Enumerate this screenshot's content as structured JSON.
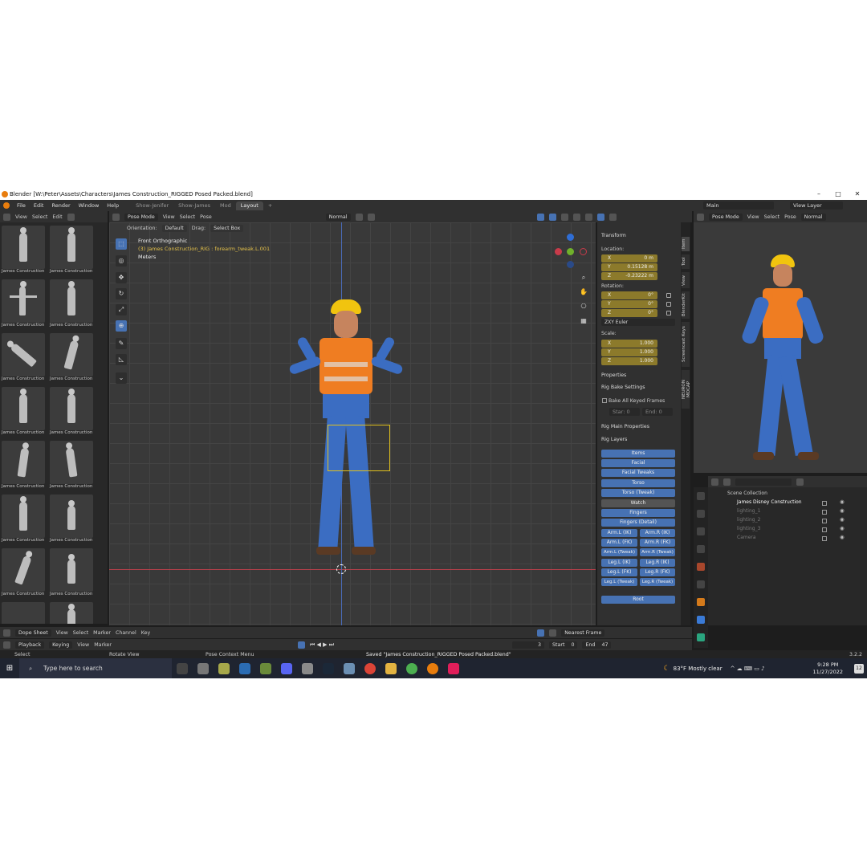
{
  "title": "Blender [W:\\Peter\\Assets\\Characters\\James Construction_RIGGED Posed Packed.blend]",
  "menu": [
    "File",
    "Edit",
    "Render",
    "Window",
    "Help"
  ],
  "workspaces": [
    "Show-Jenifer",
    "Show-James",
    "Mod",
    "Layout"
  ],
  "scene": "Main",
  "view_layer": "View Layer",
  "asset_header": {
    "view": "View",
    "select": "Select",
    "edit": "Edit"
  },
  "assets": [
    "James Construction",
    "James Construction",
    "James Construction",
    "James Construction",
    "James Construction",
    "James Construction",
    "James Construction",
    "James Construction",
    "James Construction",
    "James Construction",
    "James Construction",
    "James Construction",
    "James Construction",
    "James Construction"
  ],
  "viewport_header": {
    "mode": "Pose Mode",
    "view": "View",
    "select": "Select",
    "pose": "Pose",
    "shading": "Normal",
    "orientation_label": "Orientation:",
    "orientation": "Default",
    "drag_label": "Drag:",
    "drag": "Select Box",
    "pose_options": "Pose Options"
  },
  "viewport": {
    "view_name": "Front Orthographic",
    "object": "(3) James Construction_RIG : forearm_tweak.L.001",
    "units": "Meters"
  },
  "npanel": {
    "transform": "Transform",
    "location": "Location:",
    "loc": [
      {
        "k": "X",
        "v": "0 m"
      },
      {
        "k": "Y",
        "v": "0.15128 m"
      },
      {
        "k": "Z",
        "v": "-0.23222 m"
      }
    ],
    "rotation": "Rotation:",
    "rot": [
      {
        "k": "X",
        "v": "0°"
      },
      {
        "k": "Y",
        "v": "0°"
      },
      {
        "k": "Z",
        "v": "0°"
      }
    ],
    "rotation_mode": "ZXY Euler",
    "scale": "Scale:",
    "scl": [
      {
        "k": "X",
        "v": "1.000"
      },
      {
        "k": "Y",
        "v": "1.000"
      },
      {
        "k": "Z",
        "v": "1.000"
      }
    ],
    "properties": "Properties",
    "rig_bake": "Rig Bake Settings",
    "bake_all": "Bake All Keyed Frames",
    "start": "Star: 0",
    "end": "End: 0",
    "rig_main": "Rig Main Properties",
    "rig_layers": "Rig Layers",
    "layers_full": [
      "Items",
      "Facial",
      "Facial Tweaks",
      "Torso",
      "Torso (Tweak)",
      "Watch",
      "Fingers",
      "Fingers (Detail)"
    ],
    "layers_pairs": [
      [
        "Arm.L (IK)",
        "Arm.R (IK)"
      ],
      [
        "Arm.L (FK)",
        "Arm.R (FK)"
      ],
      [
        "Arm.L (Tweak)",
        "Arm.R (Tweak)"
      ],
      [
        "Leg.L (IK)",
        "Leg.R (IK)"
      ],
      [
        "Leg.L (FK)",
        "Leg.R (FK)"
      ],
      [
        "Leg.L (Tweak)",
        "Leg.R (Tweak)"
      ]
    ],
    "root": "Root"
  },
  "vtabs": [
    "Item",
    "Tool",
    "View",
    "BlenderKit",
    "Screencast Keys",
    "NEURON MOCAP"
  ],
  "render_header": {
    "mode": "Pose Mode",
    "view": "View",
    "select": "Select",
    "pose": "Pose",
    "shading": "Normal"
  },
  "outliner": {
    "root": "Scene Collection",
    "items": [
      "James Disney Construction",
      "lighting_1",
      "lighting_2",
      "lighting_3",
      "Camera"
    ]
  },
  "dopesheet": {
    "editor": "Dope Sheet",
    "view": "View",
    "select": "Select",
    "marker": "Marker",
    "channel": "Channel",
    "key": "Key",
    "snap": "Nearest Frame"
  },
  "timeline": {
    "playback": "Playback",
    "keying": "Keying",
    "view": "View",
    "marker": "Marker",
    "frame": "3",
    "start_label": "Start",
    "start": "0",
    "end_label": "End",
    "end": "47"
  },
  "status": {
    "select": "Select",
    "rotate": "Rotate View",
    "context": "Pose Context Menu",
    "saved": "Saved \"James Construction_RIGGED Posed Packed.blend\"",
    "version": "3.2.2"
  },
  "taskbar": {
    "search": "Type here to search",
    "weather": "83°F  Mostly clear",
    "time": "9:28 PM",
    "date": "11/27/2022",
    "notif": "12"
  }
}
